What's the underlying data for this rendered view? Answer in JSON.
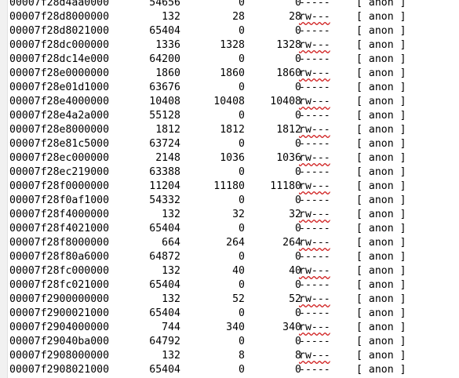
{
  "rows": [
    {
      "address": "00007f28d4aa0000",
      "kbytes": "54656",
      "rss": "0",
      "dirty": "0",
      "mode": "-----",
      "mapping": "[ anon ]"
    },
    {
      "address": "00007f28d8000000",
      "kbytes": "132",
      "rss": "28",
      "dirty": "28",
      "mode": "rw---",
      "mapping": "[ anon ]"
    },
    {
      "address": "00007f28d8021000",
      "kbytes": "65404",
      "rss": "0",
      "dirty": "0",
      "mode": "-----",
      "mapping": "[ anon ]"
    },
    {
      "address": "00007f28dc000000",
      "kbytes": "1336",
      "rss": "1328",
      "dirty": "1328",
      "mode": "rw---",
      "mapping": "[ anon ]"
    },
    {
      "address": "00007f28dc14e000",
      "kbytes": "64200",
      "rss": "0",
      "dirty": "0",
      "mode": "-----",
      "mapping": "[ anon ]"
    },
    {
      "address": "00007f28e0000000",
      "kbytes": "1860",
      "rss": "1860",
      "dirty": "1860",
      "mode": "rw---",
      "mapping": "[ anon ]"
    },
    {
      "address": "00007f28e01d1000",
      "kbytes": "63676",
      "rss": "0",
      "dirty": "0",
      "mode": "-----",
      "mapping": "[ anon ]"
    },
    {
      "address": "00007f28e4000000",
      "kbytes": "10408",
      "rss": "10408",
      "dirty": "10408",
      "mode": "rw---",
      "mapping": "[ anon ]"
    },
    {
      "address": "00007f28e4a2a000",
      "kbytes": "55128",
      "rss": "0",
      "dirty": "0",
      "mode": "-----",
      "mapping": "[ anon ]"
    },
    {
      "address": "00007f28e8000000",
      "kbytes": "1812",
      "rss": "1812",
      "dirty": "1812",
      "mode": "rw---",
      "mapping": "[ anon ]"
    },
    {
      "address": "00007f28e81c5000",
      "kbytes": "63724",
      "rss": "0",
      "dirty": "0",
      "mode": "-----",
      "mapping": "[ anon ]"
    },
    {
      "address": "00007f28ec000000",
      "kbytes": "2148",
      "rss": "1036",
      "dirty": "1036",
      "mode": "rw---",
      "mapping": "[ anon ]"
    },
    {
      "address": "00007f28ec219000",
      "kbytes": "63388",
      "rss": "0",
      "dirty": "0",
      "mode": "-----",
      "mapping": "[ anon ]"
    },
    {
      "address": "00007f28f0000000",
      "kbytes": "11204",
      "rss": "11180",
      "dirty": "11180",
      "mode": "rw---",
      "mapping": "[ anon ]"
    },
    {
      "address": "00007f28f0af1000",
      "kbytes": "54332",
      "rss": "0",
      "dirty": "0",
      "mode": "-----",
      "mapping": "[ anon ]"
    },
    {
      "address": "00007f28f4000000",
      "kbytes": "132",
      "rss": "32",
      "dirty": "32",
      "mode": "rw---",
      "mapping": "[ anon ]"
    },
    {
      "address": "00007f28f4021000",
      "kbytes": "65404",
      "rss": "0",
      "dirty": "0",
      "mode": "-----",
      "mapping": "[ anon ]"
    },
    {
      "address": "00007f28f8000000",
      "kbytes": "664",
      "rss": "264",
      "dirty": "264",
      "mode": "rw---",
      "mapping": "[ anon ]"
    },
    {
      "address": "00007f28f80a6000",
      "kbytes": "64872",
      "rss": "0",
      "dirty": "0",
      "mode": "-----",
      "mapping": "[ anon ]"
    },
    {
      "address": "00007f28fc000000",
      "kbytes": "132",
      "rss": "40",
      "dirty": "40",
      "mode": "rw---",
      "mapping": "[ anon ]"
    },
    {
      "address": "00007f28fc021000",
      "kbytes": "65404",
      "rss": "0",
      "dirty": "0",
      "mode": "-----",
      "mapping": "[ anon ]"
    },
    {
      "address": "00007f2900000000",
      "kbytes": "132",
      "rss": "52",
      "dirty": "52",
      "mode": "rw---",
      "mapping": "[ anon ]"
    },
    {
      "address": "00007f2900021000",
      "kbytes": "65404",
      "rss": "0",
      "dirty": "0",
      "mode": "-----",
      "mapping": "[ anon ]"
    },
    {
      "address": "00007f2904000000",
      "kbytes": "744",
      "rss": "340",
      "dirty": "340",
      "mode": "rw---",
      "mapping": "[ anon ]"
    },
    {
      "address": "00007f29040ba000",
      "kbytes": "64792",
      "rss": "0",
      "dirty": "0",
      "mode": "-----",
      "mapping": "[ anon ]"
    },
    {
      "address": "00007f2908000000",
      "kbytes": "132",
      "rss": "8",
      "dirty": "8",
      "mode": "rw---",
      "mapping": "[ anon ]"
    },
    {
      "address": "00007f2908021000",
      "kbytes": "65404",
      "rss": "0",
      "dirty": "0",
      "mode": "-----",
      "mapping": "[ anon ]"
    }
  ],
  "colors": {
    "text": "#000000",
    "background": "#ffffff",
    "gutter": "#f1f1f1",
    "spellcheck_underline": "#d02020"
  }
}
